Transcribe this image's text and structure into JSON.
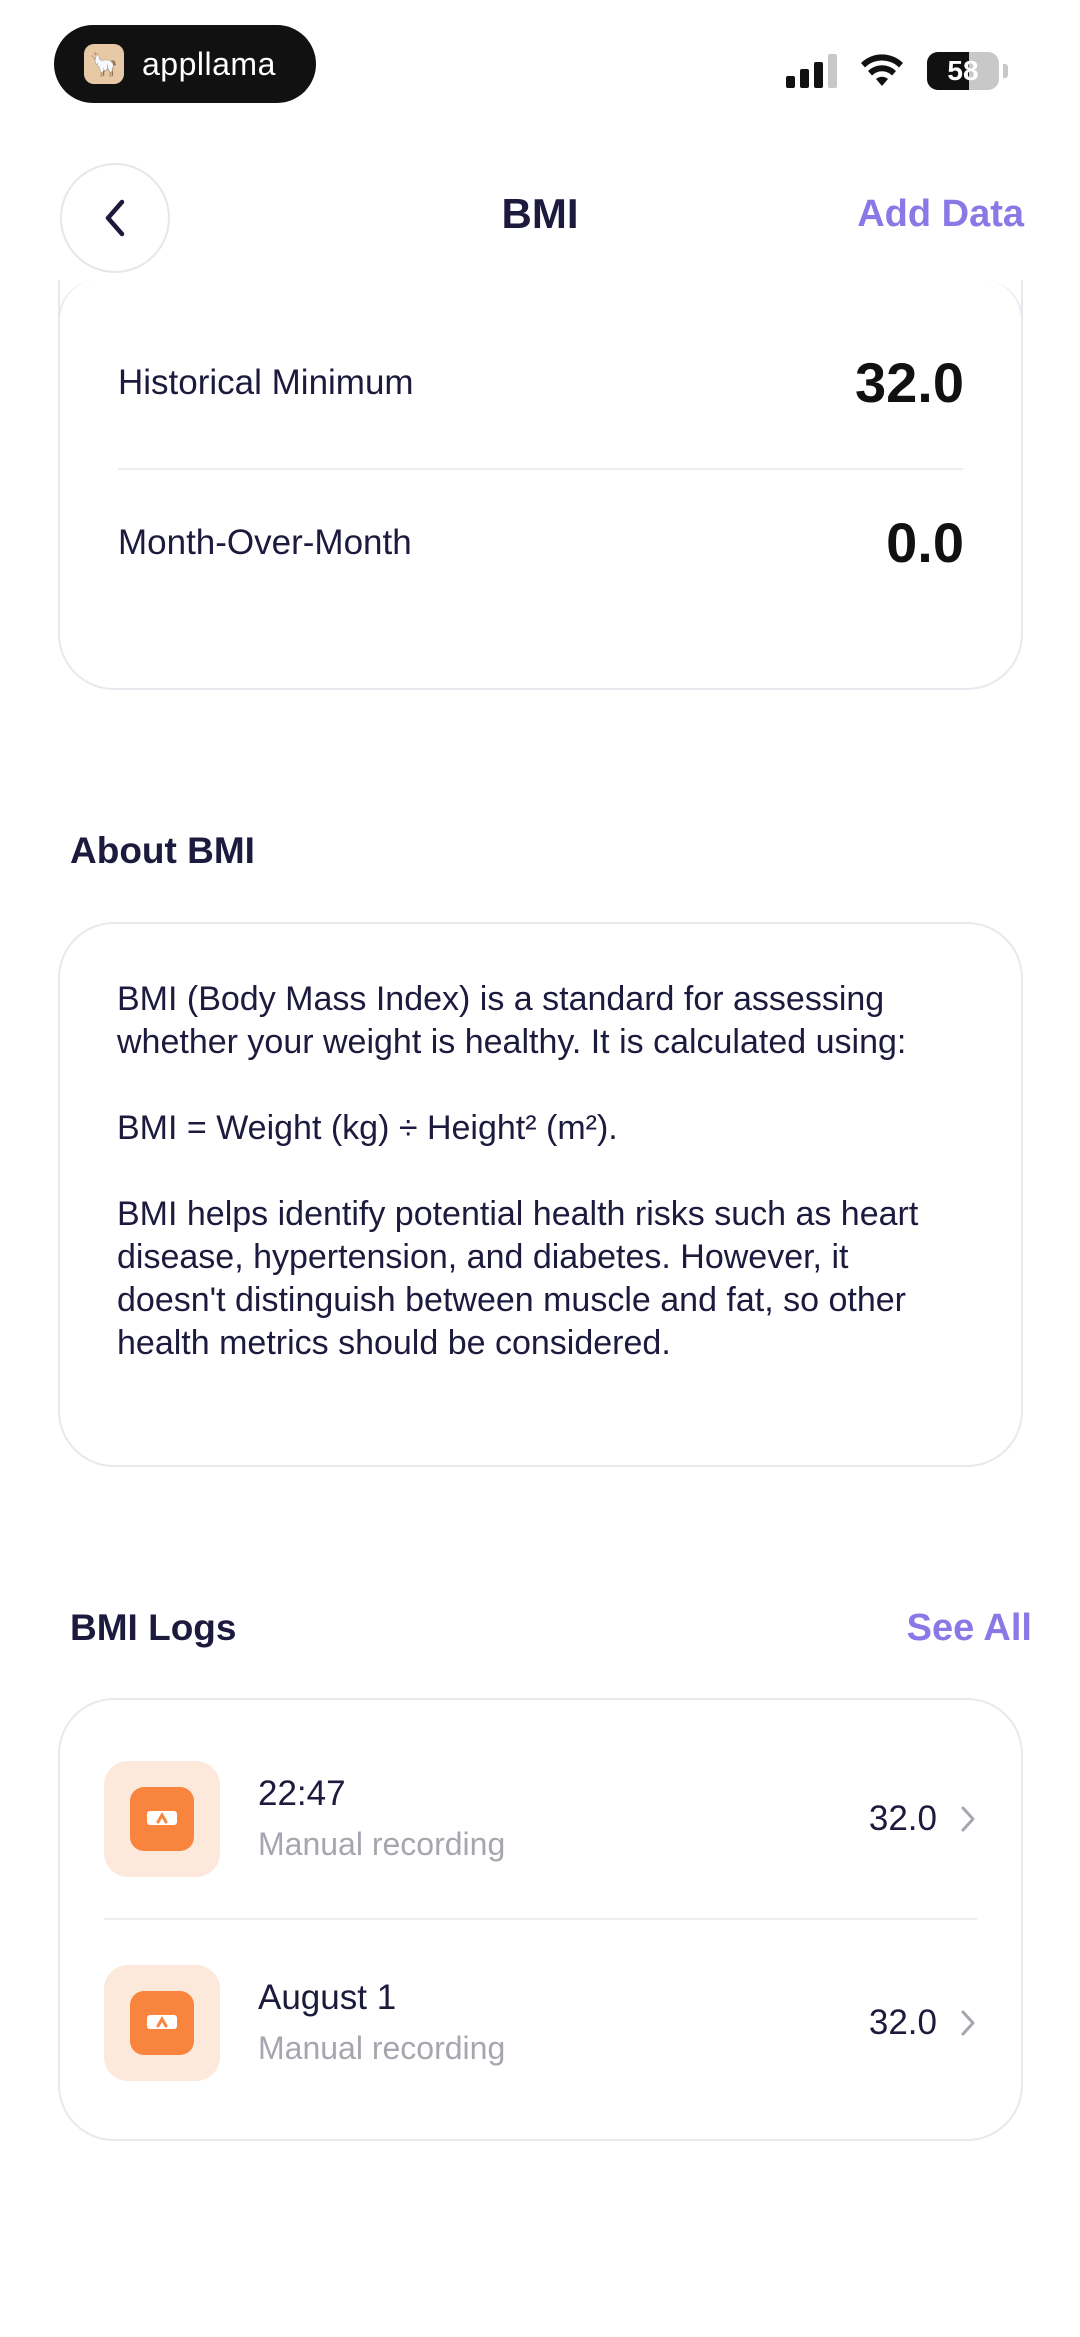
{
  "status_bar": {
    "app_name": "appllama",
    "battery": "58"
  },
  "header": {
    "title": "BMI",
    "add_data_label": "Add Data"
  },
  "stats": {
    "historical_minimum_label": "Historical Minimum",
    "historical_minimum_value": "32.0",
    "month_over_month_label": "Month-Over-Month",
    "month_over_month_value": "0.0"
  },
  "about": {
    "heading": "About BMI",
    "paragraphs": [
      "BMI (Body Mass Index) is a standard for assessing whether your weight is healthy. It is calculated using:",
      "BMI = Weight (kg) ÷ Height² (m²).",
      "BMI helps identify potential health risks such as heart disease, hypertension, and diabetes. However, it doesn't distinguish between muscle and fat, so other health metrics should be considered."
    ]
  },
  "logs": {
    "heading": "BMI Logs",
    "see_all_label": "See All",
    "items": [
      {
        "time": "22:47",
        "source": "Manual recording",
        "value": "32.0",
        "icon": "scale-icon"
      },
      {
        "time": "August 1",
        "source": "Manual recording",
        "value": "32.0",
        "icon": "scale-icon"
      }
    ]
  },
  "colors": {
    "accent": "#8b77e6",
    "text_primary": "#1c1a3d",
    "log_icon_bg": "#fde8dc",
    "log_icon": "#f8843e"
  }
}
